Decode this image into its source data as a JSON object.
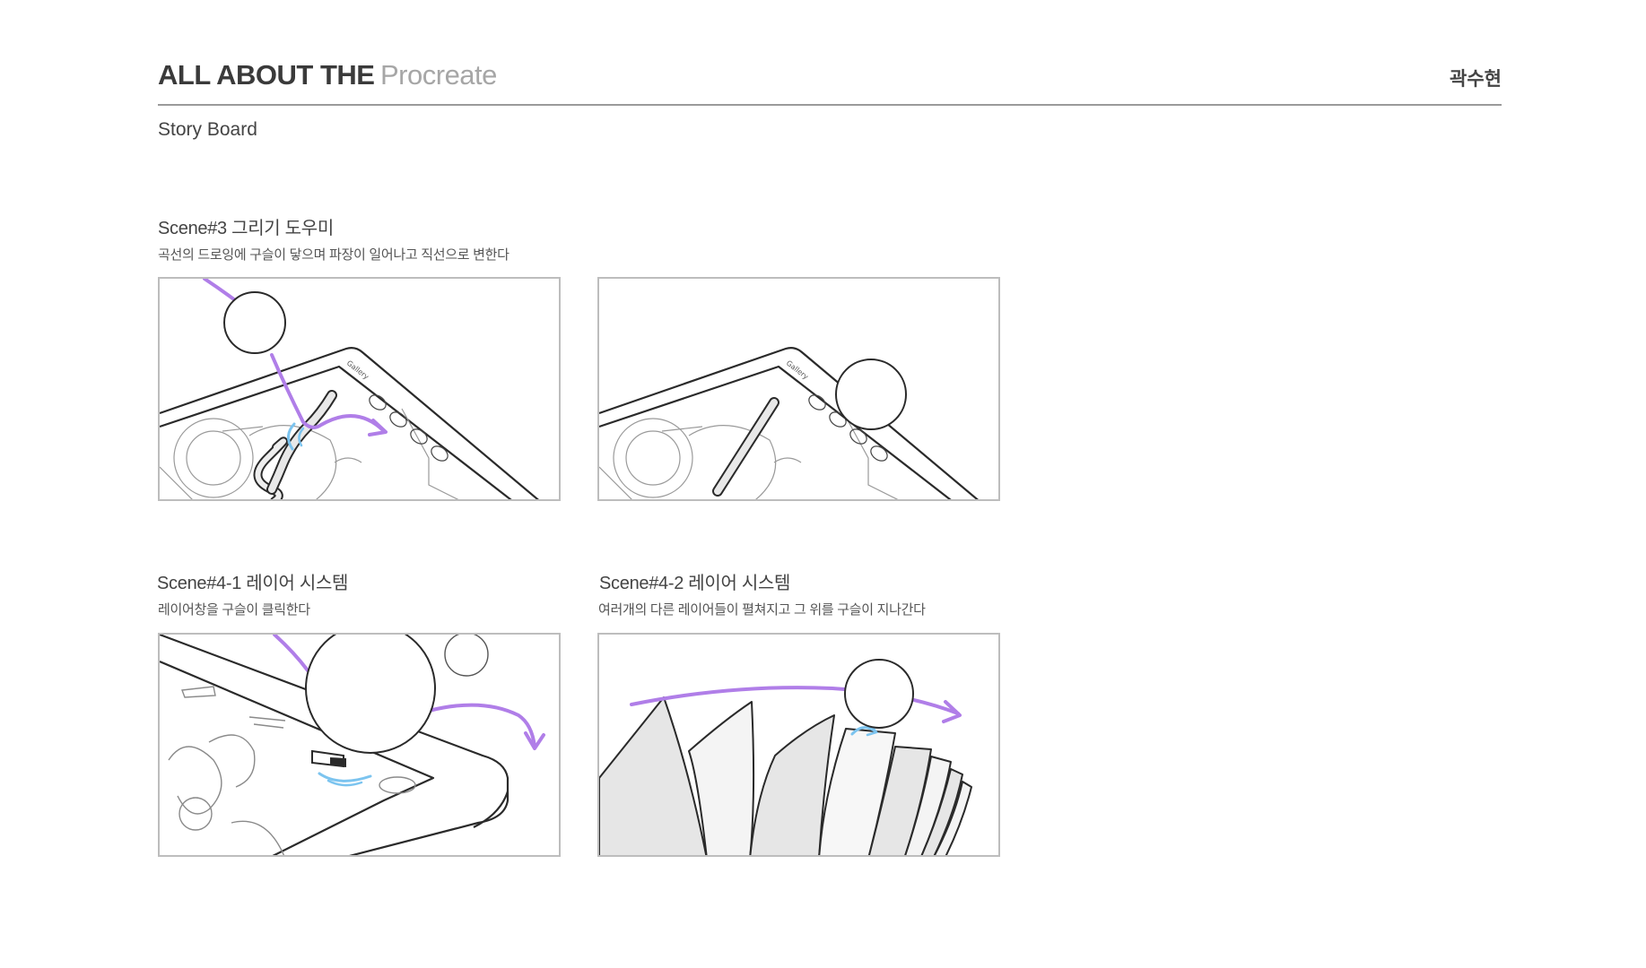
{
  "header": {
    "title_bold": "ALL ABOUT THE",
    "title_light": "Procreate",
    "author": "곽수현"
  },
  "subtitle": "Story Board",
  "scenes": [
    {
      "title": "Scene#3 그리기 도우미",
      "description": "곡선의 드로잉에 구슬이 닿으며 파장이 일어나고 직선으로 변한다"
    },
    {
      "title": "Scene#4-1 레이어 시스템",
      "description": "레이어창을 구슬이 클릭한다"
    },
    {
      "title": "Scene#4-2 레이어 시스템",
      "description": "여러개의 다른 레이어들이 펼쳐지고 그 위를 구슬이 지나간다"
    }
  ],
  "frames": [
    {
      "tablet_label": "Gallery"
    },
    {
      "tablet_label": "Gallery"
    }
  ],
  "colors": {
    "accent_purple": "#b07ee8",
    "ripple_blue": "#7cc4ef",
    "line": "#2a2a2a",
    "frame_border": "#bdbdbd",
    "title_bold": "#3a3a3a",
    "title_light": "#a6a6a6"
  }
}
